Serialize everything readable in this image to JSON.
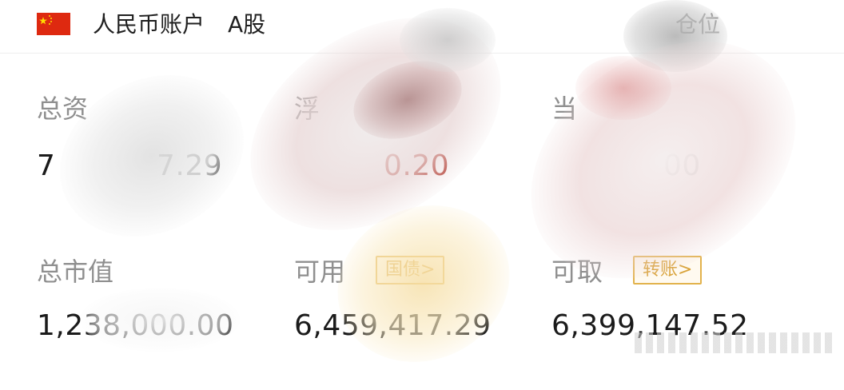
{
  "header": {
    "flag_icon": "china-flag-icon",
    "account_title": "人民币账户",
    "market": "A股",
    "position_label": "仓位"
  },
  "stats": {
    "total_assets": {
      "label": "总资",
      "value_left": "7",
      "value_right": "7.29"
    },
    "floating_pnl": {
      "label": "浮",
      "value": "0.20",
      "color": "#b33a2f"
    },
    "daily_pnl": {
      "label": "当",
      "value": "00"
    },
    "market_value": {
      "label": "总市值",
      "value": "1,238,000.00"
    },
    "available": {
      "label": "可用",
      "value": "6,459,417.29",
      "button": "国债>"
    },
    "withdrawable": {
      "label": "可取",
      "value": "6,399,147.52",
      "button": "转账>"
    }
  },
  "colors": {
    "accent_gold": "#e2b24c",
    "negative_red": "#b33a2f"
  }
}
